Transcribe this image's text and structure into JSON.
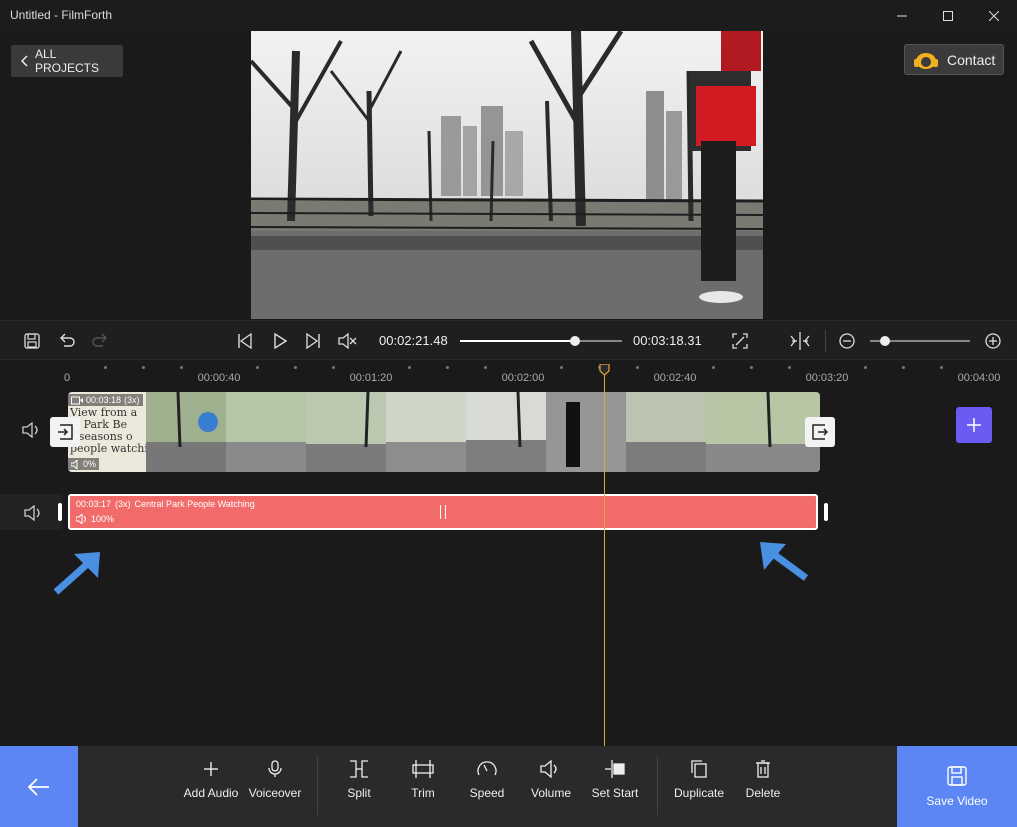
{
  "window": {
    "title": "Untitled - FilmForth",
    "controls": [
      "minimize-icon",
      "maximize-icon",
      "close-icon"
    ]
  },
  "top": {
    "all_projects_label": "ALL PROJECTS",
    "contact_label": "Contact"
  },
  "player": {
    "current_time": "00:02:21.48",
    "total_time": "00:03:18.31",
    "progress": 0.71,
    "zoom": 0.06
  },
  "ruler": {
    "labels": [
      "0",
      "00:00:40",
      "00:01:20",
      "00:02:00",
      "00:02:40",
      "00:03:20",
      "00:04:00"
    ]
  },
  "video_clip": {
    "duration": "00:03:18",
    "speed": "(3x)",
    "volume": "0%"
  },
  "audio_clip": {
    "duration": "00:03:17",
    "speed": "(3x)",
    "name": "Central Park People Watching",
    "volume": "100%"
  },
  "toolbar": {
    "add_audio": "Add Audio",
    "voiceover": "Voiceover",
    "split": "Split",
    "trim": "Trim",
    "speed": "Speed",
    "volume": "Volume",
    "set_start": "Set Start",
    "duplicate": "Duplicate",
    "delete": "Delete",
    "save_video": "Save Video"
  },
  "colors": {
    "accent": "#5b86f3",
    "audio_clip": "#f26b6b",
    "playhead": "#e0a63b",
    "add_button": "#6b5bf3"
  }
}
